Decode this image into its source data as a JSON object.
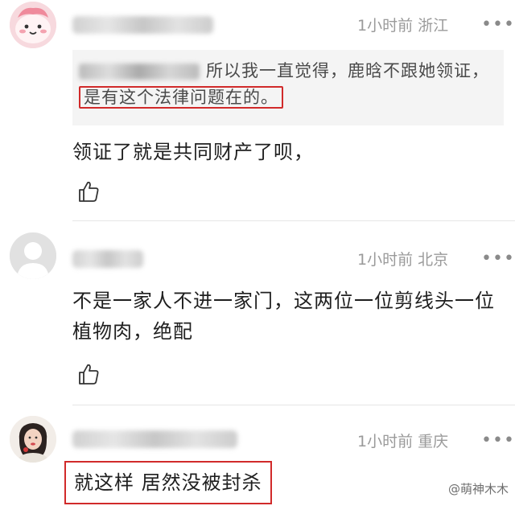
{
  "comments": [
    {
      "time": "1小时前",
      "location": "浙江",
      "more": "•••",
      "quote": {
        "text_main": "所以我一直觉得，鹿晗不跟她领证，",
        "text_highlight": "是有这个法律问题在的。"
      },
      "body": "领证了就是共同财产了呗，"
    },
    {
      "time": "1小时前",
      "location": "北京",
      "more": "•••",
      "body": "不是一家人不进一家门，这两位一位剪线头一位植物肉，绝配"
    },
    {
      "time": "1小时前",
      "location": "重庆",
      "more": "•••",
      "body": "就这样 居然没被封杀"
    }
  ],
  "watermark": "@萌神木木",
  "colors": {
    "highlight": "#d12a2a",
    "meta": "#9a9a9a",
    "quote_bg": "#f4f4f4"
  },
  "icons": [
    "avatar-pink-face",
    "avatar-default-person",
    "avatar-photo",
    "thumbs-up-icon",
    "more-icon"
  ]
}
